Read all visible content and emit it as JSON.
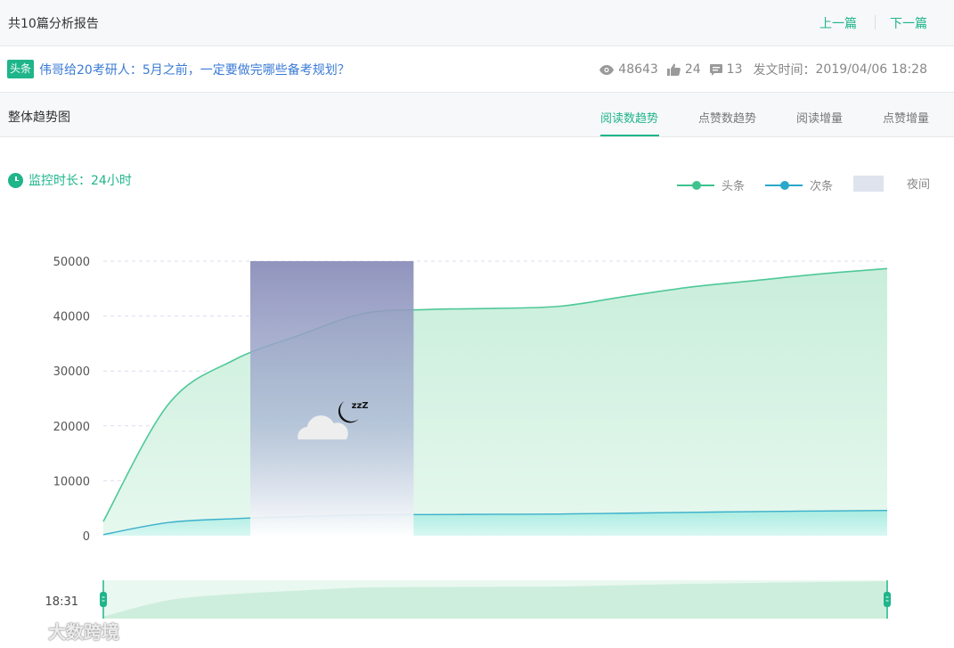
{
  "header": {
    "count_text": "共10篇分析报告",
    "prev_label": "上一篇",
    "next_label": "下一篇"
  },
  "article": {
    "tag": "头条",
    "title": "伟哥给20考研人：5月之前，一定要做完哪些备考规划？",
    "views": "48643",
    "likes": "24",
    "comments": "13",
    "publish_label": "发文时间：",
    "publish_time": "2019/04/06 18:28"
  },
  "section": {
    "title": "整体趋势图",
    "tabs": [
      "阅读数趋势",
      "点赞数趋势",
      "阅读增量",
      "点赞增量"
    ],
    "active_tab": 0
  },
  "monitor": {
    "label": "监控时长：24小时"
  },
  "legend": {
    "headline": "头条",
    "secondary": "次条",
    "night": "夜间"
  },
  "colors": {
    "accent": "#1fb58a",
    "headline": "#3ec38f",
    "secondary": "#2aa8c9",
    "night_band": "#8b8fba"
  },
  "slider": {
    "start_label": "18:31"
  },
  "watermark": {
    "text": "大数跨境"
  },
  "chart_data": {
    "type": "area",
    "ylim": [
      0,
      50000
    ],
    "y_ticks": [
      "50000",
      "40000",
      "30000",
      "20000",
      "10000",
      "0"
    ],
    "x": [
      0,
      2,
      4,
      6,
      8,
      10,
      12,
      14,
      16,
      18,
      20,
      22,
      24
    ],
    "series": [
      {
        "name": "头条",
        "values": [
          2600,
          24000,
          32000,
          36500,
          40500,
          41200,
          41400,
          41800,
          43600,
          45300,
          46500,
          47700,
          48643
        ]
      },
      {
        "name": "次条",
        "values": [
          200,
          2400,
          3100,
          3500,
          3800,
          3850,
          3900,
          3950,
          4100,
          4250,
          4400,
          4500,
          4600
        ]
      }
    ],
    "night_band": [
      4.5,
      9.5
    ]
  }
}
